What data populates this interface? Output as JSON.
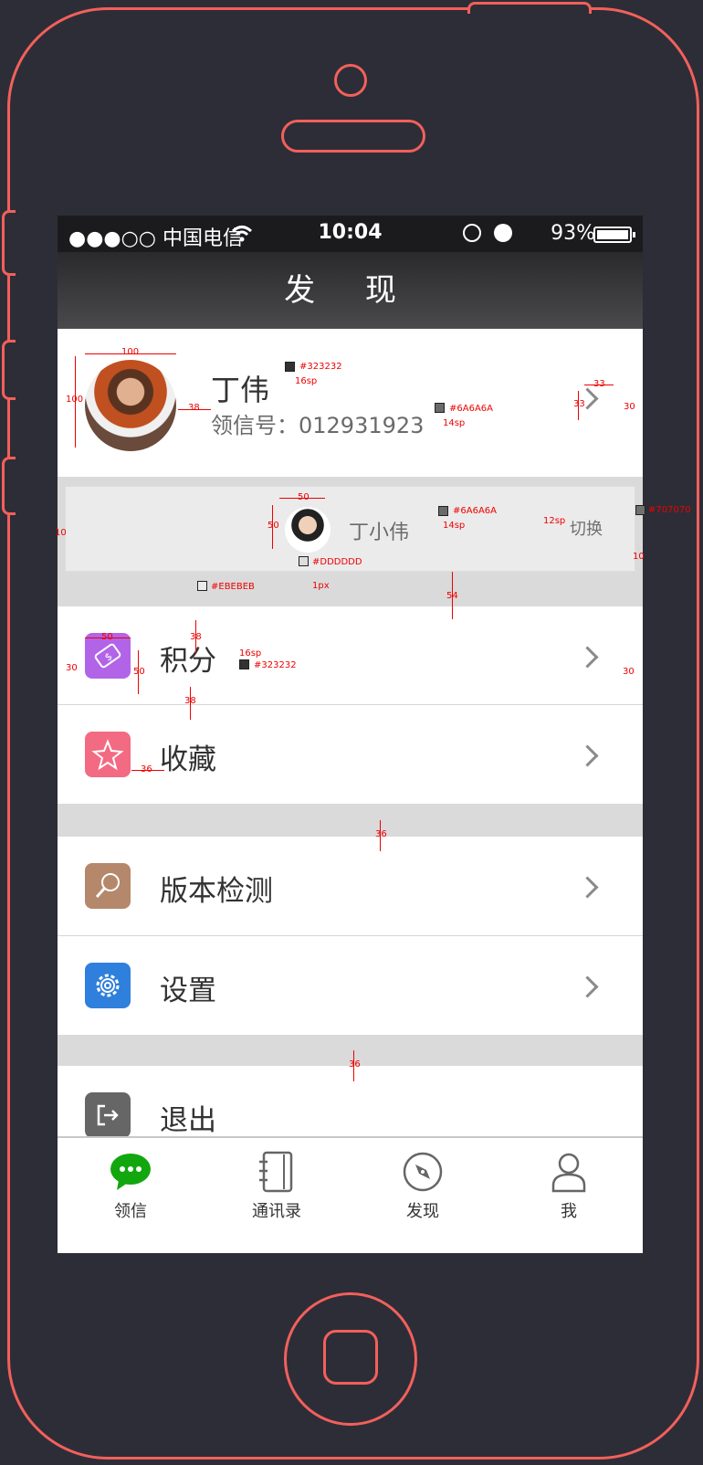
{
  "statusbar": {
    "carrier": "●●●○○ 中国电信",
    "wifi": "wifi-icon",
    "time": "10:04",
    "battery_text": "93%"
  },
  "navbar": {
    "title": "发 现"
  },
  "profile": {
    "name": "丁伟",
    "id_text": "领信号：012931923"
  },
  "switch_account": {
    "name": "丁小伟",
    "button": "切换"
  },
  "menu": [
    {
      "label": "积分",
      "icon": "ticket-icon",
      "color": "#b264e8"
    },
    {
      "label": "收藏",
      "icon": "star-icon",
      "color": "#f36a83"
    },
    {
      "label": "版本检测",
      "icon": "search-icon",
      "color": "#b5876b"
    },
    {
      "label": "设置",
      "icon": "gear-icon",
      "color": "#2f7fdc"
    },
    {
      "label": "退出",
      "icon": "logout-icon",
      "color": "#666666"
    }
  ],
  "tabs": [
    {
      "label": "领信",
      "icon": "chat-icon",
      "color": "#12a70f"
    },
    {
      "label": "通讯录",
      "icon": "contacts-icon",
      "color": "#666666"
    },
    {
      "label": "发现",
      "icon": "compass-icon",
      "color": "#666666"
    },
    {
      "label": "我",
      "icon": "user-icon",
      "color": "#666666"
    }
  ],
  "annotations": {
    "c1": "#323232",
    "s1": "16sp",
    "c2": "#6A6A6A",
    "s2": "14sp",
    "c3": "#6A6A6A",
    "s3": "14sp",
    "c4": "#707070",
    "s4": "12sp",
    "c5": "#DDDDDD",
    "s5": "1px",
    "c6": "#EBEBEB",
    "c7": "#323232",
    "s7": "16sp",
    "m100a": "100",
    "m100b": "100",
    "m38a": "38",
    "m33a": "33",
    "m33b": "33",
    "m30a": "30",
    "m50a": "50",
    "m50b": "50",
    "m10a": "10",
    "m10b": "10",
    "m54": "54",
    "m50c": "50",
    "m50d": "50",
    "m38b": "38",
    "m38c": "38",
    "m30b": "30",
    "m30c": "30",
    "m36a": "36",
    "m36b": "36",
    "m36c": "36"
  }
}
